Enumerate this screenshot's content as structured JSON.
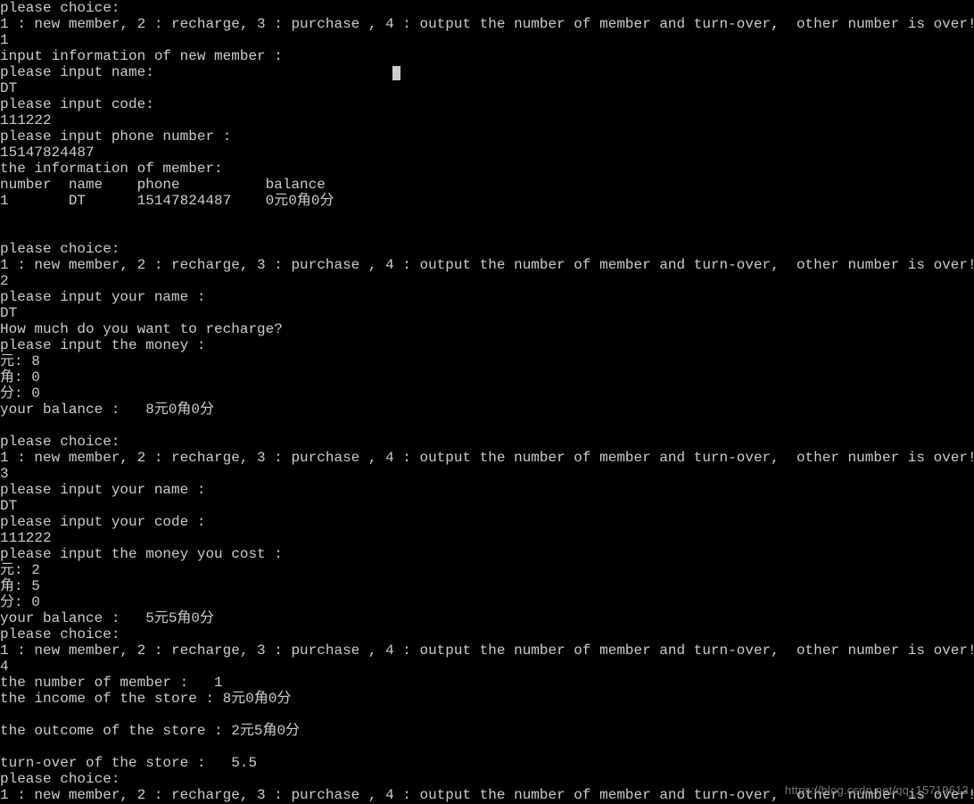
{
  "lines": [
    "please choice:",
    "1 : new member, 2 : recharge, 3 : purchase , 4 : output the number of member and turn-over,  other number is over!",
    "1",
    "input information of new member :",
    "please input name:",
    "DT",
    "please input code:",
    "111222",
    "please input phone number :",
    "15147824487",
    "the information of member:",
    "number  name    phone          balance",
    "1       DT      15147824487    0元0角0分",
    "",
    "",
    "please choice:",
    "1 : new member, 2 : recharge, 3 : purchase , 4 : output the number of member and turn-over,  other number is over!",
    "2",
    "please input your name :",
    "DT",
    "How much do you want to recharge?",
    "please input the money :",
    "元: 8",
    "角: 0",
    "分: 0",
    "your balance :   8元0角0分",
    "",
    "please choice:",
    "1 : new member, 2 : recharge, 3 : purchase , 4 : output the number of member and turn-over,  other number is over!",
    "3",
    "please input your name :",
    "DT",
    "please input your code :",
    "111222",
    "please input the money you cost :",
    "元: 2",
    "角: 5",
    "分: 0",
    "your balance :   5元5角0分",
    "please choice:",
    "1 : new member, 2 : recharge, 3 : purchase , 4 : output the number of member and turn-over,  other number is over!",
    "4",
    "the number of member :   1",
    "the income of the store : 8元0角0分",
    "",
    "the outcome of the store : 2元5角0分",
    "",
    "turn-over of the store :   5.5",
    "please choice:",
    "1 : new member, 2 : recharge, 3 : purchase , 4 : output the number of member and turn-over,  other number is over!"
  ],
  "watermark": "https://blog.csdn.net/qq_15719613",
  "session_data": {
    "menu_prompt": "please choice:",
    "menu_options": "1 : new member, 2 : recharge, 3 : purchase , 4 : output the number of member and turn-over,  other number is over!",
    "step1": {
      "choice": "1",
      "header": "input information of new member :",
      "name_prompt": "please input name:",
      "name": "DT",
      "code_prompt": "please input code:",
      "code": "111222",
      "phone_prompt": "please input phone number :",
      "phone": "15147824487",
      "info_header": "the information of member:",
      "table_header": {
        "number": "number",
        "name": "name",
        "phone": "phone",
        "balance": "balance"
      },
      "table_row": {
        "number": "1",
        "name": "DT",
        "phone": "15147824487",
        "balance": "0元0角0分"
      }
    },
    "step2": {
      "choice": "2",
      "name_prompt": "please input your name :",
      "name": "DT",
      "question": "How much do you want to recharge?",
      "money_prompt": "please input the money :",
      "yuan": "8",
      "jiao": "0",
      "fen": "0",
      "balance_label": "your balance :",
      "balance": "8元0角0分"
    },
    "step3": {
      "choice": "3",
      "name_prompt": "please input your name :",
      "name": "DT",
      "code_prompt": "please input your code :",
      "code": "111222",
      "cost_prompt": "please input the money you cost :",
      "yuan": "2",
      "jiao": "5",
      "fen": "0",
      "balance_label": "your balance :",
      "balance": "5元5角0分"
    },
    "step4": {
      "choice": "4",
      "member_count_label": "the number of member :",
      "member_count": "1",
      "income_label": "the income of the store :",
      "income": "8元0角0分",
      "outcome_label": "the outcome of the store :",
      "outcome": "2元5角0分",
      "turnover_label": "turn-over of the store :",
      "turnover": "5.5"
    }
  }
}
